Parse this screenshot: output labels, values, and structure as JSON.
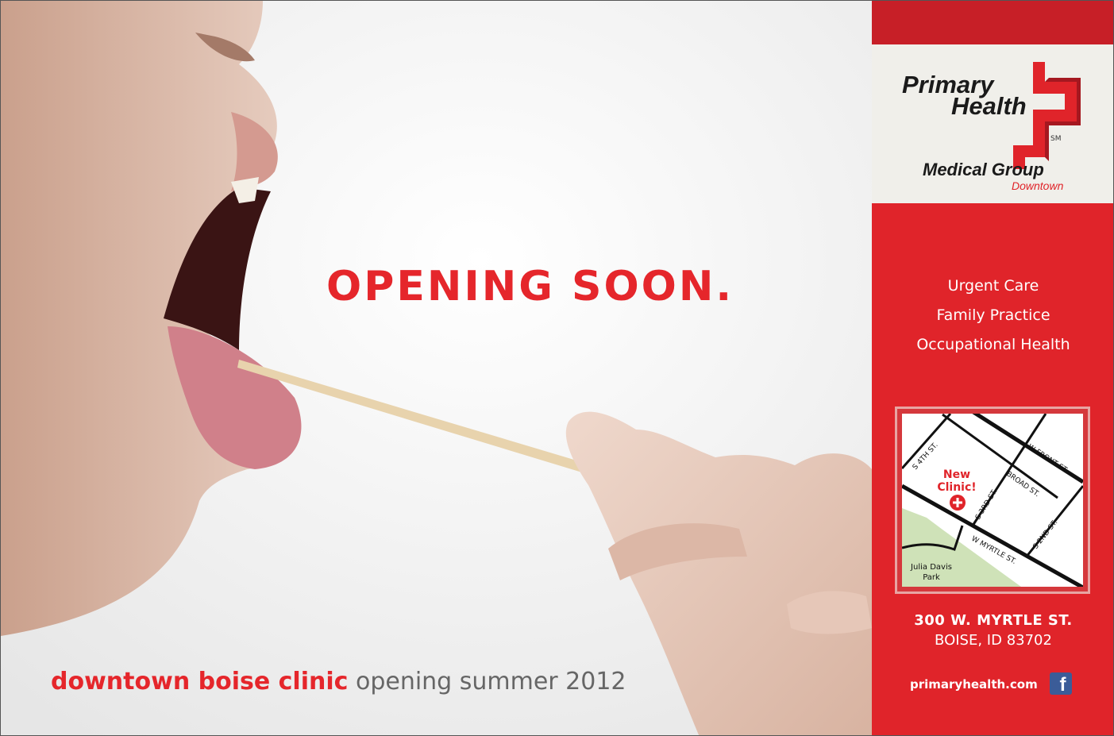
{
  "headline": "OPENING SOON.",
  "tagline": {
    "strong": "downtown boise clinic",
    "rest": " opening summer 2012"
  },
  "logo": {
    "line1": "Primary",
    "line2": "Health",
    "sm": "SM",
    "line3": "Medical Group",
    "line4": "Downtown"
  },
  "services": [
    "Urgent Care",
    "Family Practice",
    "Occupational Health"
  ],
  "map": {
    "streets": {
      "s4th": "S 4TH ST.",
      "wfront": "W FRONT ST.",
      "broad": "BROAD ST.",
      "s3rd": "S 3RD ST.",
      "s2nd": "S 2ND ST.",
      "wmyrtle": "W MYRTLE ST."
    },
    "clinic_line1": "New",
    "clinic_line2": "Clinic!",
    "park_line1": "Julia Davis",
    "park_line2": "Park"
  },
  "address": {
    "line1": "300 W. MYRTLE ST.",
    "line2": "BOISE, ID 83702"
  },
  "website": "primaryhealth.com",
  "facebook_glyph": "f",
  "colors": {
    "brand_red": "#e0242a",
    "dark_red": "#c71f27",
    "facebook_blue": "#3b5c98"
  }
}
